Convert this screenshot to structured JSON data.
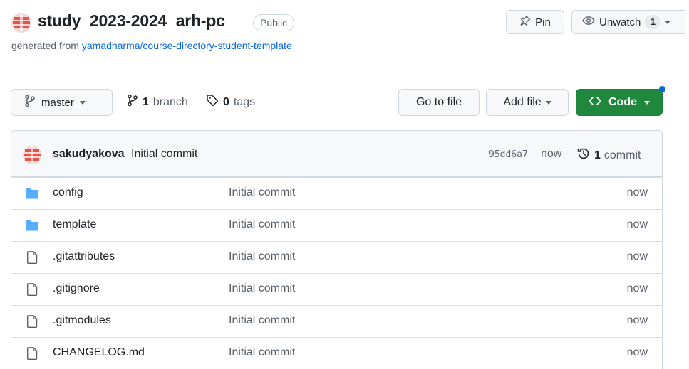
{
  "repo": {
    "title": "study_2023-2024_arh-pc",
    "visibility": "Public",
    "generated_prefix": "generated from ",
    "template_link": "yamadharma/course-directory-student-template"
  },
  "actions": {
    "pin_label": "Pin",
    "unwatch_label": "Unwatch",
    "watch_count": "1"
  },
  "toolbar": {
    "branch_name": "master",
    "branch_count": "1",
    "branch_word": "branch",
    "tag_count": "0",
    "tag_word": "tags",
    "go_to_file": "Go to file",
    "add_file": "Add file",
    "code": "Code"
  },
  "latest_commit": {
    "author": "sakudyakova",
    "message": "Initial commit",
    "sha": "95dd6a7",
    "time": "now",
    "commit_count": "1",
    "commit_word": "commit"
  },
  "files": [
    {
      "type": "folder",
      "name": "config",
      "commit": "Initial commit",
      "age": "now"
    },
    {
      "type": "folder",
      "name": "template",
      "commit": "Initial commit",
      "age": "now"
    },
    {
      "type": "file",
      "name": ".gitattributes",
      "commit": "Initial commit",
      "age": "now"
    },
    {
      "type": "file",
      "name": ".gitignore",
      "commit": "Initial commit",
      "age": "now"
    },
    {
      "type": "file",
      "name": ".gitmodules",
      "commit": "Initial commit",
      "age": "now"
    },
    {
      "type": "file",
      "name": "CHANGELOG.md",
      "commit": "Initial commit",
      "age": "now"
    }
  ],
  "colors": {
    "accent_link": "#0969da",
    "code_button": "#1f883d",
    "folder_icon": "#54aeff",
    "avatar_red": "#e5534b"
  }
}
